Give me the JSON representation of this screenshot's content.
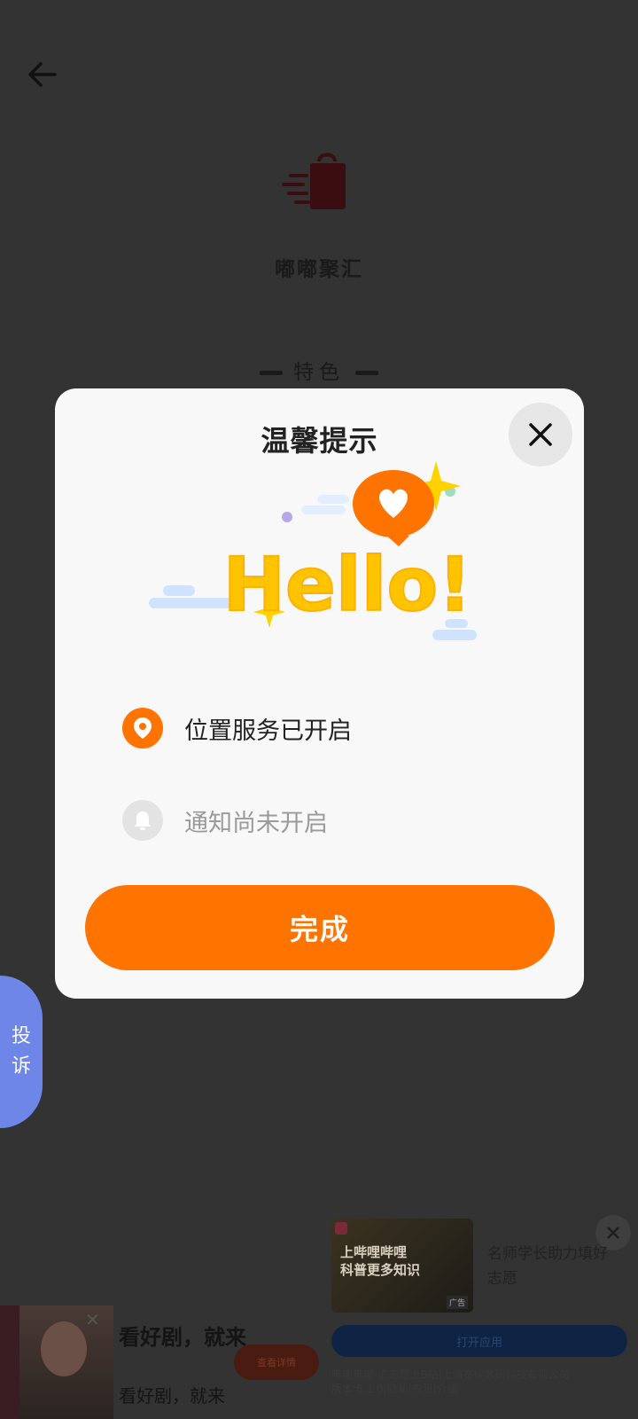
{
  "app": {
    "name": "嘟嘟聚汇",
    "feature_title": "特色"
  },
  "complaint_tab": {
    "line1": "投",
    "line2": "诉"
  },
  "modal": {
    "title": "温馨提示",
    "illustration_text": "Hello!",
    "items": [
      {
        "icon": "location-pin-icon",
        "label": "位置服务已开启",
        "enabled": true
      },
      {
        "icon": "bell-icon",
        "label": "通知尚未开启",
        "enabled": false
      }
    ],
    "done_label": "完成"
  },
  "ad_right": {
    "thumb_text_line1": "上哔哩哔哩",
    "thumb_text_line2": "科普更多知识",
    "thumb_badge": "广告",
    "title": "名师学长助力填好志愿",
    "button_label": "打开应用",
    "footer_line1": "哔哩哔哩-追志愿上B站|上海宽娱数码科技有限公司",
    "footer_line2": "版本:8.1.0|隐私|权限|介绍"
  },
  "ad_left": {
    "title": "看好剧，就来",
    "button_label": "查看详情",
    "subtitle": "看好剧，就来"
  },
  "colors": {
    "accent": "#ff7300",
    "overlay_background": "#333333",
    "complaint_tab": "#6d86e8",
    "modal_background": "#f8f8f8"
  }
}
